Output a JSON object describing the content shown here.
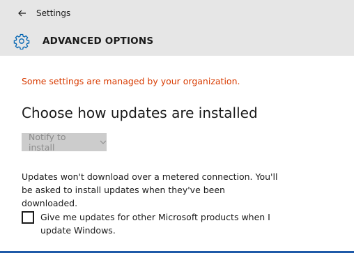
{
  "window": {
    "app_title": "Settings"
  },
  "header": {
    "page_title": "ADVANCED OPTIONS"
  },
  "content": {
    "warning": "Some settings are managed by your organization.",
    "section_title": "Choose how updates are installed",
    "install_select": {
      "selected": "Notify to install"
    },
    "description": "Updates won't download over a metered connection. You'll be asked to install updates when they've been downloaded.",
    "checkbox": {
      "label": "Give me updates for other Microsoft products when I update Windows.",
      "checked": false
    }
  },
  "colors": {
    "warning_text": "#d83b01",
    "header_bg": "#e6e6e6",
    "accent_gear": "#0063b1",
    "disabled_select_bg": "#cccccc"
  },
  "icons": [
    "back-arrow-icon",
    "gear-icon",
    "chevron-down-icon"
  ]
}
